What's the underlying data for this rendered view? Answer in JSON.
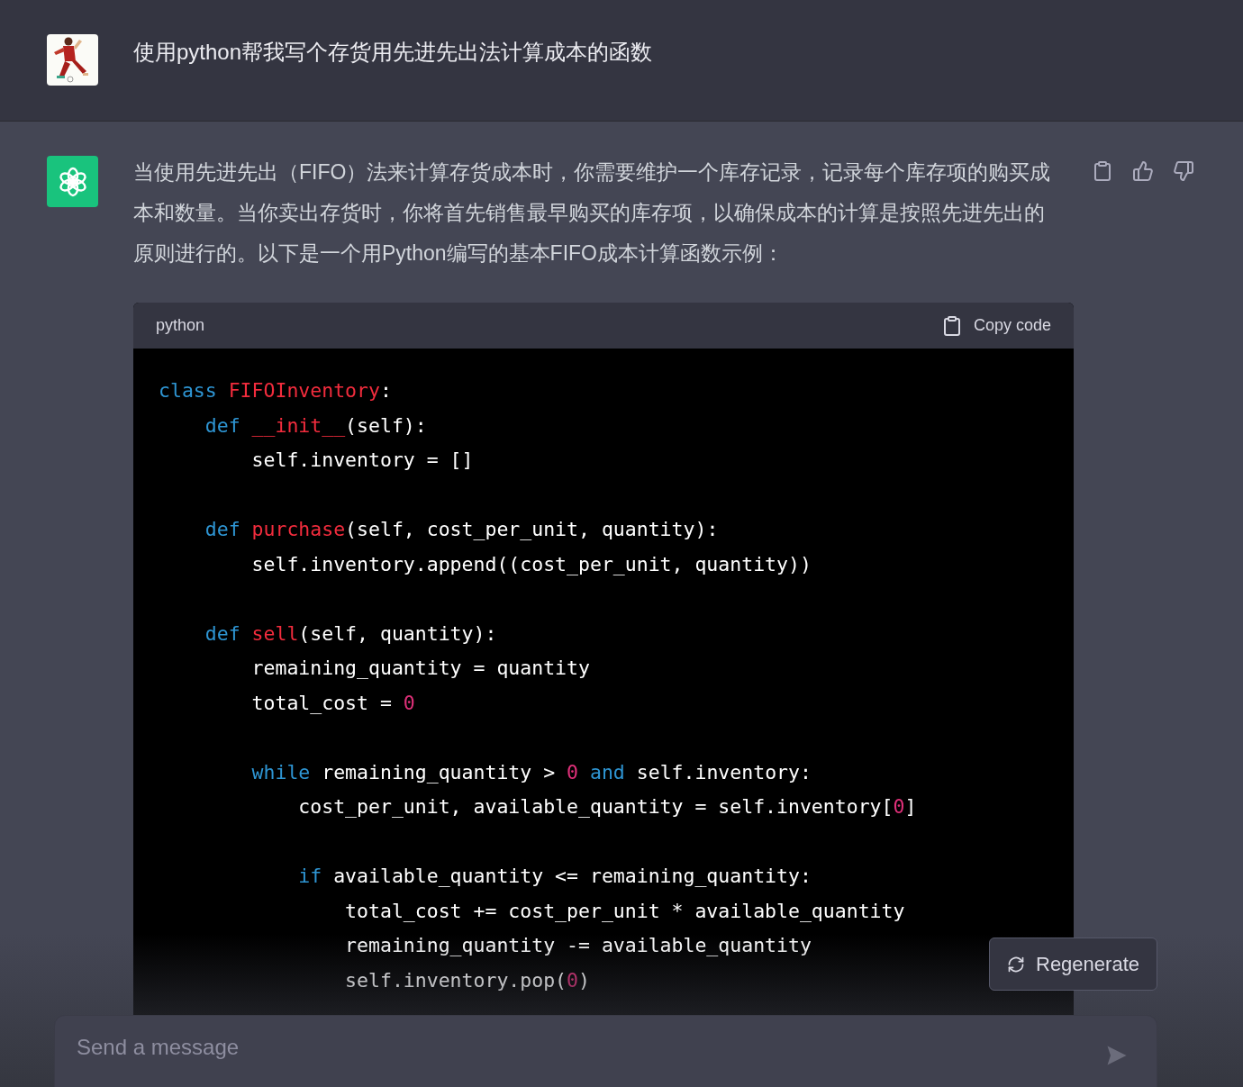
{
  "user_message": {
    "text": "使用python帮我写个存货用先进先出法计算成本的函数"
  },
  "assistant_message": {
    "text": "当使用先进先出（FIFO）法来计算存货成本时，你需要维护一个库存记录，记录每个库存项的购买成本和数量。当你卖出存货时，你将首先销售最早购买的库存项，以确保成本的计算是按照先进先出的原则进行的。以下是一个用Python编写的基本FIFO成本计算函数示例：",
    "code_block": {
      "language": "python",
      "copy_label": "Copy code",
      "lines": [
        {
          "kind": "code",
          "tokens": [
            {
              "kind": "keyword",
              "text": "class"
            },
            {
              "kind": "name",
              "text": " FIFOInventory"
            },
            {
              "kind": "plain",
              "text": ":"
            }
          ]
        },
        {
          "kind": "code",
          "tokens": [
            {
              "kind": "keyword",
              "text": "    def"
            },
            {
              "kind": "name",
              "text": " __init__"
            },
            {
              "kind": "plain",
              "text": "(self):"
            }
          ]
        },
        {
          "kind": "code",
          "tokens": [
            {
              "kind": "plain",
              "text": "        self.inventory = []"
            }
          ]
        },
        {
          "kind": "blank"
        },
        {
          "kind": "code",
          "tokens": [
            {
              "kind": "keyword",
              "text": "    def"
            },
            {
              "kind": "name",
              "text": " purchase"
            },
            {
              "kind": "plain",
              "text": "(self, cost_per_unit, quantity):"
            }
          ]
        },
        {
          "kind": "code",
          "tokens": [
            {
              "kind": "plain",
              "text": "        self.inventory.append((cost_per_unit, quantity))"
            }
          ]
        },
        {
          "kind": "blank"
        },
        {
          "kind": "code",
          "tokens": [
            {
              "kind": "keyword",
              "text": "    def"
            },
            {
              "kind": "name",
              "text": " sell"
            },
            {
              "kind": "plain",
              "text": "(self, quantity):"
            }
          ]
        },
        {
          "kind": "code",
          "tokens": [
            {
              "kind": "plain",
              "text": "        remaining_quantity = quantity"
            }
          ]
        },
        {
          "kind": "code",
          "tokens": [
            {
              "kind": "plain",
              "text": "        total_cost = "
            },
            {
              "kind": "number",
              "text": "0"
            }
          ]
        },
        {
          "kind": "blank"
        },
        {
          "kind": "code",
          "tokens": [
            {
              "kind": "keyword",
              "text": "        while"
            },
            {
              "kind": "plain",
              "text": " remaining_quantity > "
            },
            {
              "kind": "number",
              "text": "0"
            },
            {
              "kind": "keyword",
              "text": " and"
            },
            {
              "kind": "plain",
              "text": " self.inventory:"
            }
          ]
        },
        {
          "kind": "code",
          "tokens": [
            {
              "kind": "plain",
              "text": "            cost_per_unit, available_quantity = self.inventory["
            },
            {
              "kind": "number",
              "text": "0"
            },
            {
              "kind": "plain",
              "text": "]"
            }
          ]
        },
        {
          "kind": "blank"
        },
        {
          "kind": "code",
          "tokens": [
            {
              "kind": "keyword",
              "text": "            if"
            },
            {
              "kind": "plain",
              "text": " available_quantity <= remaining_quantity:"
            }
          ]
        },
        {
          "kind": "code",
          "tokens": [
            {
              "kind": "plain",
              "text": "                total_cost += cost_per_unit * available_quantity"
            }
          ]
        },
        {
          "kind": "code",
          "tokens": [
            {
              "kind": "plain",
              "text": "                remaining_quantity -= available_quantity"
            }
          ]
        },
        {
          "kind": "code",
          "tokens": [
            {
              "kind": "plain",
              "text": "                self.inventory.pop("
            },
            {
              "kind": "number",
              "text": "0"
            },
            {
              "kind": "plain",
              "text": ")"
            }
          ]
        }
      ]
    }
  },
  "regenerate_button": {
    "label": "Regenerate"
  },
  "composer": {
    "placeholder": "Send a message"
  }
}
